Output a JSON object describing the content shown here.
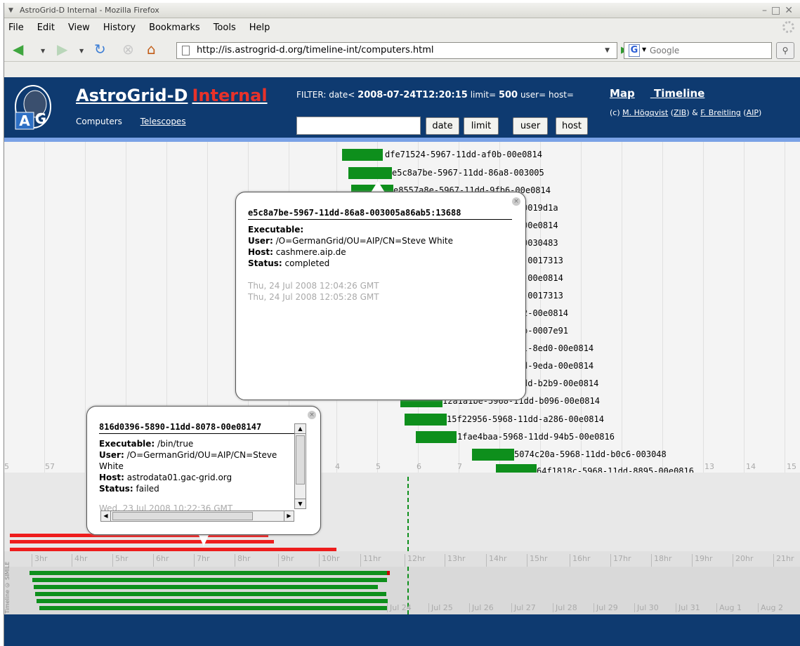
{
  "window": {
    "title": "AstroGrid-D Internal - Mozilla Firefox"
  },
  "menu": [
    "File",
    "Edit",
    "View",
    "History",
    "Bookmarks",
    "Tools",
    "Help"
  ],
  "nav": {
    "url": "http://is.astrogrid-d.org/timeline-int/computers.html",
    "search_placeholder": "Google"
  },
  "banner": {
    "title": "AstroGrid-D",
    "title_red": "Internal",
    "links": [
      "Computers",
      "Telescopes"
    ],
    "filter_prefix": "FILTER: date<",
    "filter_date": "2008-07-24T12:20:15",
    "filter_limit_label": "limit=",
    "filter_limit": "500",
    "filter_user": "user=",
    "filter_host": "host=",
    "buttons": [
      "date",
      "limit",
      "user",
      "host"
    ],
    "top_links": [
      "Map",
      "Timeline"
    ],
    "credit_prefix": "(c)",
    "credit_name1": "M. Högqvist",
    "credit_org1": "ZIB",
    "credit_amp": "&",
    "credit_name2": "F. Breitling",
    "credit_org2": "AIP"
  },
  "events": [
    {
      "label": "dfe71524-5967-11dd-af0b-00e0814"
    },
    {
      "label": "e5c8a7be-5967-11dd-86a8-003005"
    },
    {
      "label": "e8557a8e-5967-11dd-9fb6-00e0814"
    },
    {
      "label": "0019d1a"
    },
    {
      "label": "00e0814"
    },
    {
      "label": "0030483"
    },
    {
      "label": "-0017313"
    },
    {
      "label": "-00e0814"
    },
    {
      "label": "-0017313"
    },
    {
      "label": "2-00e0814"
    },
    {
      "label": "b-0007e91"
    },
    {
      "label": "l-8ed0-00e0814"
    },
    {
      "label": "d-9eda-00e0814"
    },
    {
      "label": "dd-b2b9-00e0814"
    },
    {
      "label": "12a1a1be-5968-11dd-b096-00e0814"
    },
    {
      "label": "15f22956-5968-11dd-a286-00e0814"
    },
    {
      "label": "1fae4baa-5968-11dd-94b5-00e0816"
    },
    {
      "label": "5074c20a-5968-11dd-b0c6-003048"
    },
    {
      "label": "64f1818c-5968-11dd-8895-00e0816"
    }
  ],
  "top_ticks": [
    "5",
    "57",
    "4",
    "5",
    "6",
    "7",
    "13",
    "14",
    "15"
  ],
  "hour_ticks": [
    "3hr",
    "4hr",
    "5hr",
    "6hr",
    "7hr",
    "8hr",
    "9hr",
    "10hr",
    "11hr",
    "12hr",
    "13hr",
    "14hr",
    "15hr",
    "16hr",
    "17hr",
    "18hr",
    "19hr",
    "20hr",
    "21hr"
  ],
  "day_ticks": [
    "Jul 24",
    "Jul 25",
    "Jul 26",
    "Jul 27",
    "Jul 28",
    "Jul 29",
    "Jul 30",
    "Jul 31",
    "Aug 1",
    "Aug 2"
  ],
  "simile": "Timeline © SIMILE",
  "popup1": {
    "title": "e5c8a7be-5967-11dd-86a8-003005a86ab5:13688",
    "executable_label": "Executable:",
    "executable": "",
    "user_label": "User:",
    "user": "/O=GermanGrid/OU=AIP/CN=Steve White",
    "host_label": "Host:",
    "host": "cashmere.aip.de",
    "status_label": "Status:",
    "status": "completed",
    "start": "Thu, 24 Jul 2008 12:04:26 GMT",
    "end": "Thu, 24 Jul 2008 12:05:28 GMT"
  },
  "popup2": {
    "title": "816d0396-5890-11dd-8078-00e08147",
    "executable_label": "Executable:",
    "executable": "/bin/true",
    "user_label": "User:",
    "user": "/O=GermanGrid/OU=AIP/CN=Steve White",
    "host_label": "Host:",
    "host": "astrodata01.gac-grid.org",
    "status_label": "Status:",
    "status": "failed",
    "start": "Wed, 23 Jul 2008 10:22:36 GMT"
  }
}
